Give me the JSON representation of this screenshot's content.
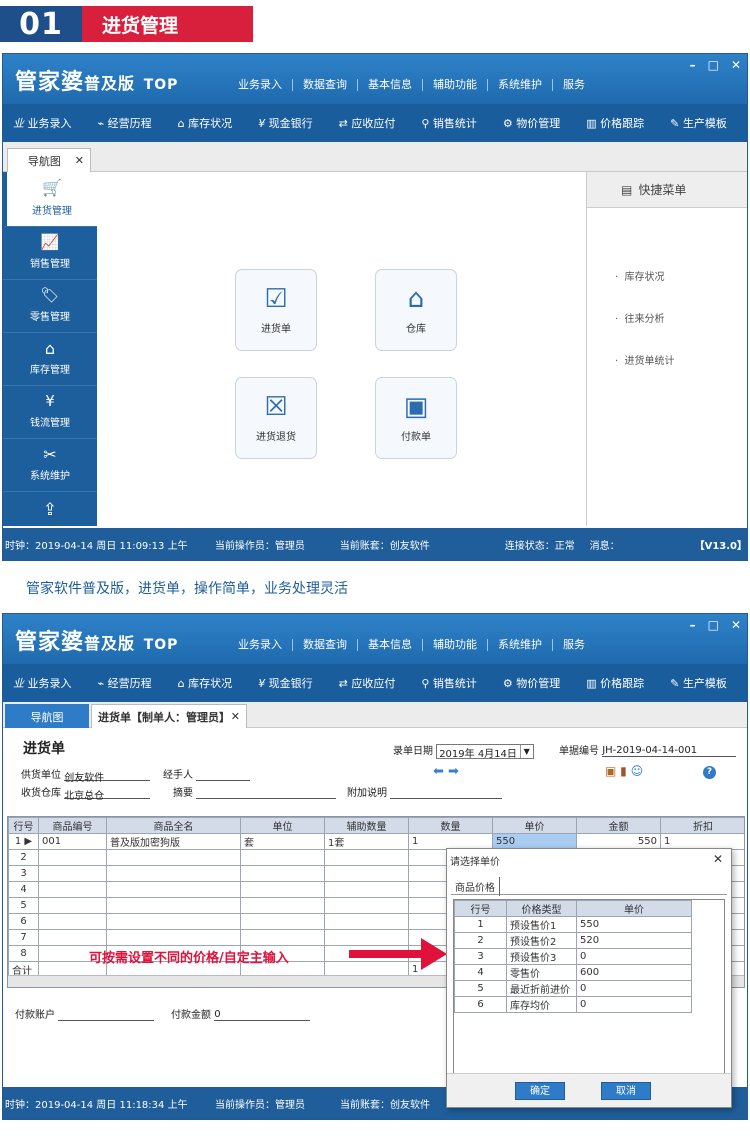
{
  "banner": {
    "number": "01",
    "title": "进货管理"
  },
  "app": {
    "brand": "管家婆",
    "edition": "普及版",
    "suffix": "TOP",
    "top_menu": [
      "业务录入",
      "数据查询",
      "基本信息",
      "辅助功能",
      "系统维护",
      "服务"
    ],
    "window_buttons": [
      "–",
      "□",
      "✕"
    ],
    "toolbar": [
      "业务录入",
      "经营历程",
      "库存状况",
      "现金银行",
      "应收应付",
      "销售统计",
      "物价管理",
      "价格跟踪",
      "生产模板"
    ],
    "toolbar_icons": [
      "业",
      "⌁",
      "⌂",
      "¥",
      "⇄",
      "⚲",
      "⚙",
      "▥",
      "✎"
    ]
  },
  "window1": {
    "tab": "导航图",
    "sidenav": [
      {
        "label": "进货管理",
        "icon": "cart-icon",
        "glyph": "🛒"
      },
      {
        "label": "销售管理",
        "icon": "chart-icon",
        "glyph": "📈"
      },
      {
        "label": "零售管理",
        "icon": "tag-icon",
        "glyph": "🏷"
      },
      {
        "label": "库存管理",
        "icon": "warehouse-icon",
        "glyph": "⌂"
      },
      {
        "label": "钱流管理",
        "icon": "money-icon",
        "glyph": "¥"
      },
      {
        "label": "系统维护",
        "icon": "tools-icon",
        "glyph": "✂"
      },
      {
        "label": "",
        "icon": "share-icon",
        "glyph": "⇪"
      }
    ],
    "cards": [
      {
        "label": "进货单",
        "icon": "checklist-icon",
        "glyph": "☑"
      },
      {
        "label": "仓库",
        "icon": "house-icon",
        "glyph": "⌂"
      },
      {
        "label": "进货退货",
        "icon": "return-icon",
        "glyph": "☒"
      },
      {
        "label": "付款单",
        "icon": "wallet-icon",
        "glyph": "▣"
      }
    ],
    "quick_menu": {
      "title": "快捷菜单",
      "items": [
        "库存状况",
        "往来分析",
        "进货单统计"
      ]
    },
    "status": {
      "clock": "时钟：2019-04-14 周日 11:09:13 上午",
      "operator": "当前操作员：管理员",
      "account": "当前账套：创友软件",
      "connection": "连接状态：正常",
      "message": "消息：",
      "version": "【V13.0】"
    }
  },
  "caption": "管家软件普及版，进货单，操作简单，业务处理灵活",
  "window2": {
    "tabs": [
      "导航图",
      "进货单【制单人：管理员】"
    ],
    "form_title": "进货单",
    "record_date_label": "录单日期",
    "record_date_value": "2019年 4月14日",
    "doc_no_label": "单据编号",
    "doc_no_value": "JH-2019-04-14-001",
    "supplier_label": "供货单位",
    "supplier_value": "创友软件",
    "handler_label": "经手人",
    "warehouse_label": "收货仓库",
    "warehouse_value": "北京总仓",
    "summary_label": "摘要",
    "note_label": "附加说明",
    "columns": [
      "行号",
      "商品编号",
      "商品全名",
      "单位",
      "辅助数量",
      "数量",
      "单价",
      "金额",
      "折扣"
    ],
    "row1": [
      "1",
      "001",
      "普及版加密狗版",
      "套",
      "1套",
      "1",
      "550",
      "550",
      "1"
    ],
    "row_numbers": [
      "2",
      "3",
      "4",
      "5",
      "6",
      "7",
      "8"
    ],
    "total_label": "合计",
    "total_qty": "1",
    "annotation": "可按需设置不同的价格/自定主输入",
    "pay_account_label": "付款账户",
    "pay_amount_label": "付款金额",
    "pay_amount_value": "0",
    "dialog": {
      "title": "请选择单价",
      "tab": "商品价格",
      "columns": [
        "行号",
        "价格类型",
        "单价"
      ],
      "rows": [
        [
          "1",
          "预设售价1",
          "550"
        ],
        [
          "2",
          "预设售价2",
          "520"
        ],
        [
          "3",
          "预设售价3",
          "0"
        ],
        [
          "4",
          "零售价",
          "600"
        ],
        [
          "5",
          "最近折前进价",
          "0"
        ],
        [
          "6",
          "库存均价",
          "0"
        ]
      ],
      "ok": "确定",
      "cancel": "取消"
    },
    "status": {
      "clock": "时钟：2019-04-14 周日 11:18:34 上午",
      "operator": "当前操作员：管理员",
      "account": "当前账套：创友软件"
    }
  },
  "colors": {
    "brand_blue": "#1f5e9a",
    "banner_red": "#d81f3c",
    "annotation_red": "#e0113a"
  }
}
